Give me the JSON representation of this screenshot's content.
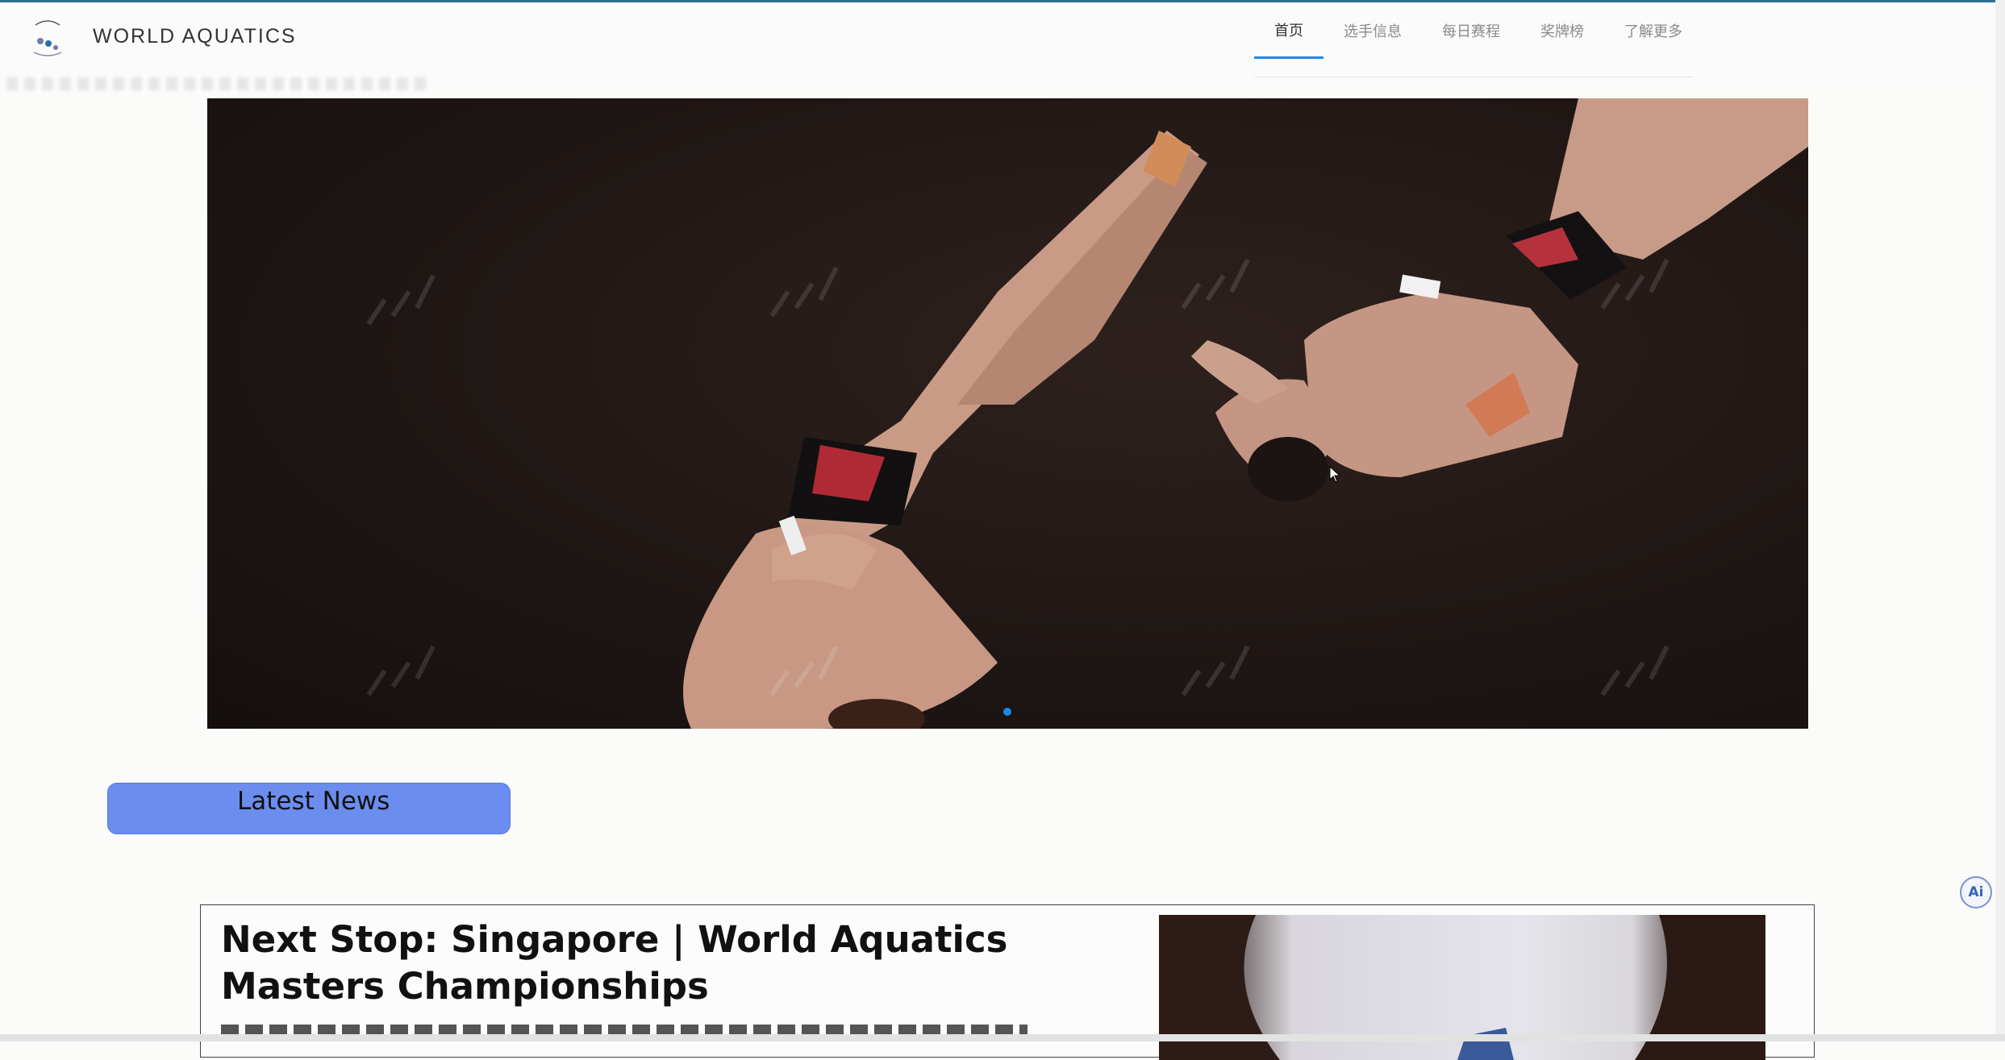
{
  "brand": {
    "name": "WORLD AQUATICS"
  },
  "nav": {
    "items": [
      {
        "label": "首页",
        "active": true
      },
      {
        "label": "选手信息",
        "active": false
      },
      {
        "label": "每日赛程",
        "active": false
      },
      {
        "label": "奖牌榜",
        "active": false
      },
      {
        "label": "了解更多",
        "active": false
      }
    ]
  },
  "hero": {
    "watermark": "墨刀",
    "slide_count": 1,
    "active_slide": 1
  },
  "news": {
    "button_label": "Latest News",
    "card": {
      "title": "Next Stop: Singapore | World Aquatics Masters Championships"
    }
  },
  "ai": {
    "label": "Ai"
  },
  "colors": {
    "accent": "#1e88e5",
    "news_button": "#6b8def",
    "hero_bg": "#1e1614"
  }
}
